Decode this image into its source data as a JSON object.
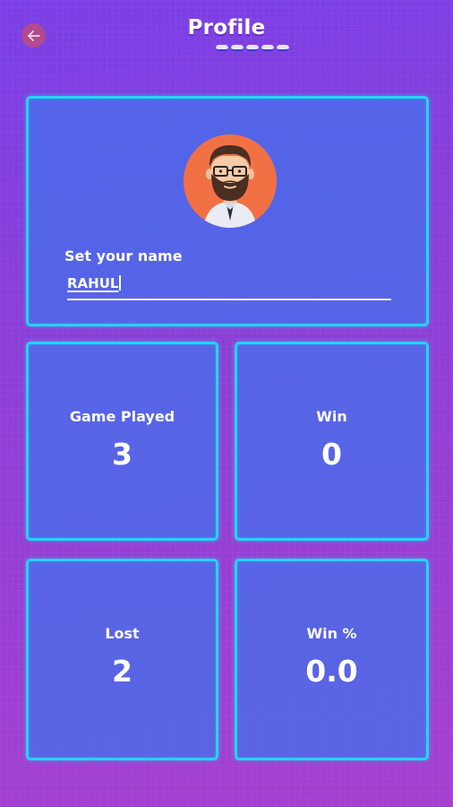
{
  "header": {
    "title": "Profile",
    "back_icon": "arrow-left-icon"
  },
  "profile": {
    "avatar_icon": "bearded-man-avatar",
    "name_label": "Set your name",
    "name_value": "RAHUL"
  },
  "stats": [
    {
      "label": "Game Played",
      "value": "3"
    },
    {
      "label": "Win",
      "value": "0"
    },
    {
      "label": "Lost",
      "value": "2"
    },
    {
      "label": "Win %",
      "value": "0.0"
    }
  ],
  "colors": {
    "card_border": "#27d3f5",
    "card_fill": "#466eeb",
    "avatar_bg": "#f27144",
    "back_button": "#b14a8e"
  }
}
